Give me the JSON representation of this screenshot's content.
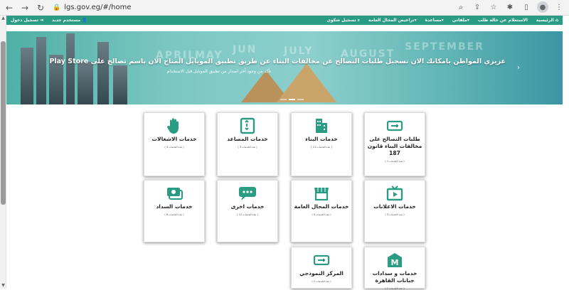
{
  "browser": {
    "url": "lgs.gov.eg/#/home"
  },
  "nav": {
    "left": [
      {
        "label": "تسجيل دخول",
        "icon": "login-icon"
      },
      {
        "label": "مستخدم جديد",
        "icon": "user-icon"
      }
    ],
    "right": [
      {
        "label": "الرئيسية",
        "icon": "home-icon"
      },
      {
        "label": "الاستعلام عن حالة طلب"
      },
      {
        "label": "ملفاتي▾"
      },
      {
        "label": "مساعدة▾"
      },
      {
        "label": "تراخيص المحال العامة▾"
      },
      {
        "label": "تسجيل شكوى",
        "icon": "search-icon"
      }
    ]
  },
  "hero": {
    "title": "عزيزي المواطن بامكانك الان تسجيل طلبات التصالح عن مخالفات البناء عن طريق تطبيق الموبايل المتاح الان باسم تصالح على Play Store",
    "subtitle": "تأكد من وجود آخر اصدار من تطبيق الموبايل قبل الاستخدام",
    "ghost": [
      "APRIL",
      "MAY",
      "JUN",
      "JULY",
      "AUGUST",
      "SEPTEMBER"
    ]
  },
  "services": [
    {
      "title": "طلبات التصالح على مخالفات البناء قانون 187",
      "count": "( عدد الخدمات 1 )",
      "icon": "ticket-icon",
      "color": "#2a9c84"
    },
    {
      "title": "خدمات البناء",
      "count": "( عدد الخدمات 11 )",
      "icon": "building-icon",
      "color": "#2a9c84"
    },
    {
      "title": "خدمات المصاعد",
      "count": "( عدد الخدمات 3 )",
      "icon": "elevator-icon",
      "color": "#2a9c84"
    },
    {
      "title": "خدمات الاشغالات",
      "count": "( عدد الخدمات 4 )",
      "icon": "hand-icon",
      "color": "#2a9c84"
    },
    {
      "title": "خدمات الاعلانات",
      "count": "( عدد الخدمات 3 )",
      "icon": "tv-icon",
      "color": "#2a9c84"
    },
    {
      "title": "خدمات المحال العامة",
      "count": "( عدد الخدمات 4 )",
      "icon": "shop-icon",
      "color": "#2a9c84"
    },
    {
      "title": "خدمات اخرى",
      "count": "( عدد الخدمات 12 )",
      "icon": "chat-icon",
      "color": "#2a9c84"
    },
    {
      "title": "خدمات السداد",
      "count": "( عدد الخدمات 6 )",
      "icon": "cash-icon",
      "color": "#2a9c84"
    },
    {
      "title": "خدمات و سدادات جبانات القاهرة",
      "count": "( عدد الخدمات 1 )",
      "icon": "m-building-icon",
      "color": "#2a9c84"
    },
    {
      "title": "المركز النموذجي",
      "count": "( عدد الخدمات 1 )",
      "icon": "ticket-icon",
      "color": "#2a9c84"
    }
  ]
}
